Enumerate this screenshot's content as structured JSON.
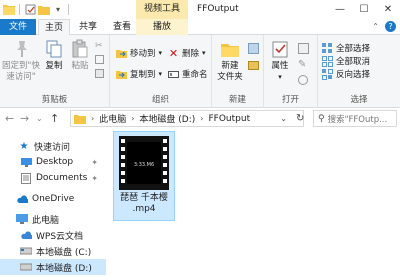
{
  "title_bar": {
    "context_tab_label": "视频工具",
    "window_title": "FFOutput"
  },
  "tabs": {
    "file": "文件",
    "home": "主页",
    "share": "共享",
    "view": "查看",
    "play": "播放"
  },
  "ribbon": {
    "clipboard": {
      "pin_label": "固定到\"快速访问\"",
      "copy_label": "复制",
      "paste_label": "粘贴",
      "group_label": "剪贴板"
    },
    "organize": {
      "move_to": "移动到",
      "copy_to": "复制到",
      "delete": "删除",
      "rename": "重命名",
      "group_label": "组织"
    },
    "new": {
      "new_folder": "新建\n文件夹",
      "group_label": "新建"
    },
    "open": {
      "properties": "属性",
      "group_label": "打开"
    },
    "select": {
      "select_all": "全部选择",
      "select_none": "全部取消",
      "invert": "反向选择",
      "group_label": "选择"
    }
  },
  "address": {
    "crumbs": [
      "此电脑",
      "本地磁盘 (D:)",
      "FFOutput"
    ],
    "search_placeholder": "搜索\"FFOutp..."
  },
  "nav": {
    "quick_access": "快速访问",
    "desktop": "Desktop",
    "documents": "Documents",
    "onedrive": "OneDrive",
    "this_pc": "此电脑",
    "wps": "WPS云文档",
    "drive_c": "本地磁盘 (C:)",
    "drive_d": "本地磁盘 (D:)"
  },
  "files": [
    {
      "name": "琵琶 千本樱\n.mp4",
      "thumb_text": "3:33.M6"
    }
  ],
  "colors": {
    "file_tab": "#1979ca",
    "selection": "#cce8ff",
    "context_tab": "#fbe9ad"
  }
}
